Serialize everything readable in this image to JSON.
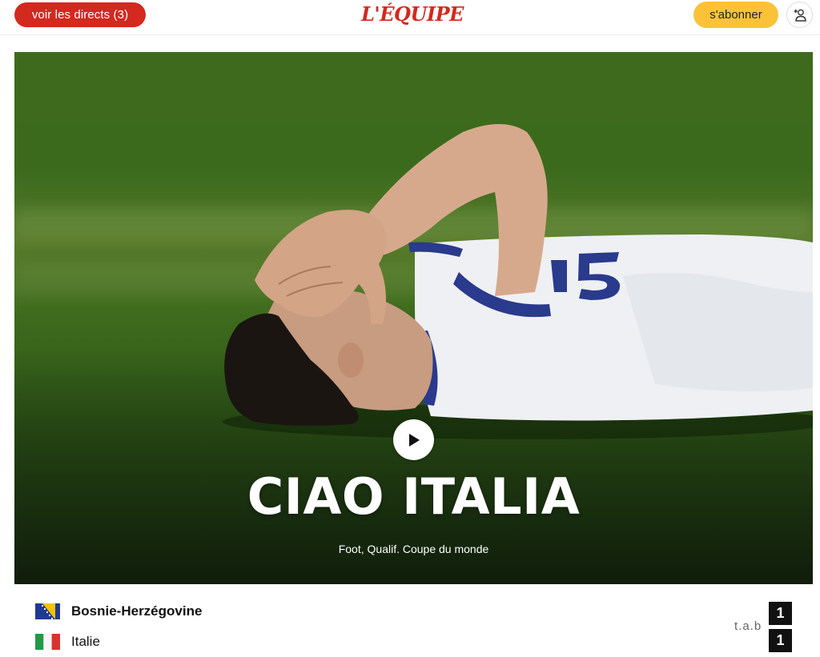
{
  "header": {
    "live_label": "voir les directs (3)",
    "logo_text": "L'ÉQUIPE",
    "subscribe_label": "s'abonner",
    "account_icon": "user-add-icon"
  },
  "hero": {
    "headline": "CIAO ITALIA",
    "category": "Foot, Qualif. Coupe du monde",
    "play_icon": "play-icon"
  },
  "match": {
    "home": {
      "name": "Bosnie-Herzégovine",
      "score": "1",
      "flag": "bosnia-flag"
    },
    "away": {
      "name": "Italie",
      "score": "1",
      "flag": "italy-flag"
    },
    "result_note": "t.a.b"
  },
  "colors": {
    "brand_red": "#d3291f",
    "subscribe_yellow": "#f9c239",
    "score_bg": "#111111"
  }
}
